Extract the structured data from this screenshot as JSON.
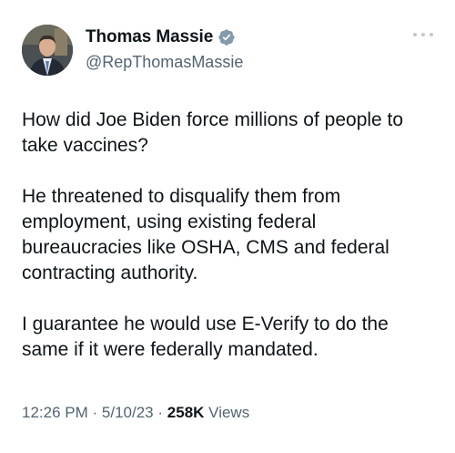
{
  "author": {
    "display_name": "Thomas Massie",
    "handle": "@RepThomasMassie",
    "verified_icon": "verified-badge-icon",
    "verified_color": "#1d9bf0"
  },
  "tweet": {
    "paragraphs": [
      "How did Joe Biden force millions of people to\ntake vaccines?",
      "He threatened to disqualify them from\nemployment, using existing federal\nbureaucracies like OSHA, CMS and federal\ncontracting authority.",
      "I guarantee he would use E-Verify to do the\nsame if it were federally mandated."
    ],
    "time": "12:26 PM",
    "sep1": "·",
    "date": "5/10/23",
    "sep2": "·",
    "views_count": "258K",
    "views_label": "Views"
  },
  "more_icon": "more-options-icon"
}
